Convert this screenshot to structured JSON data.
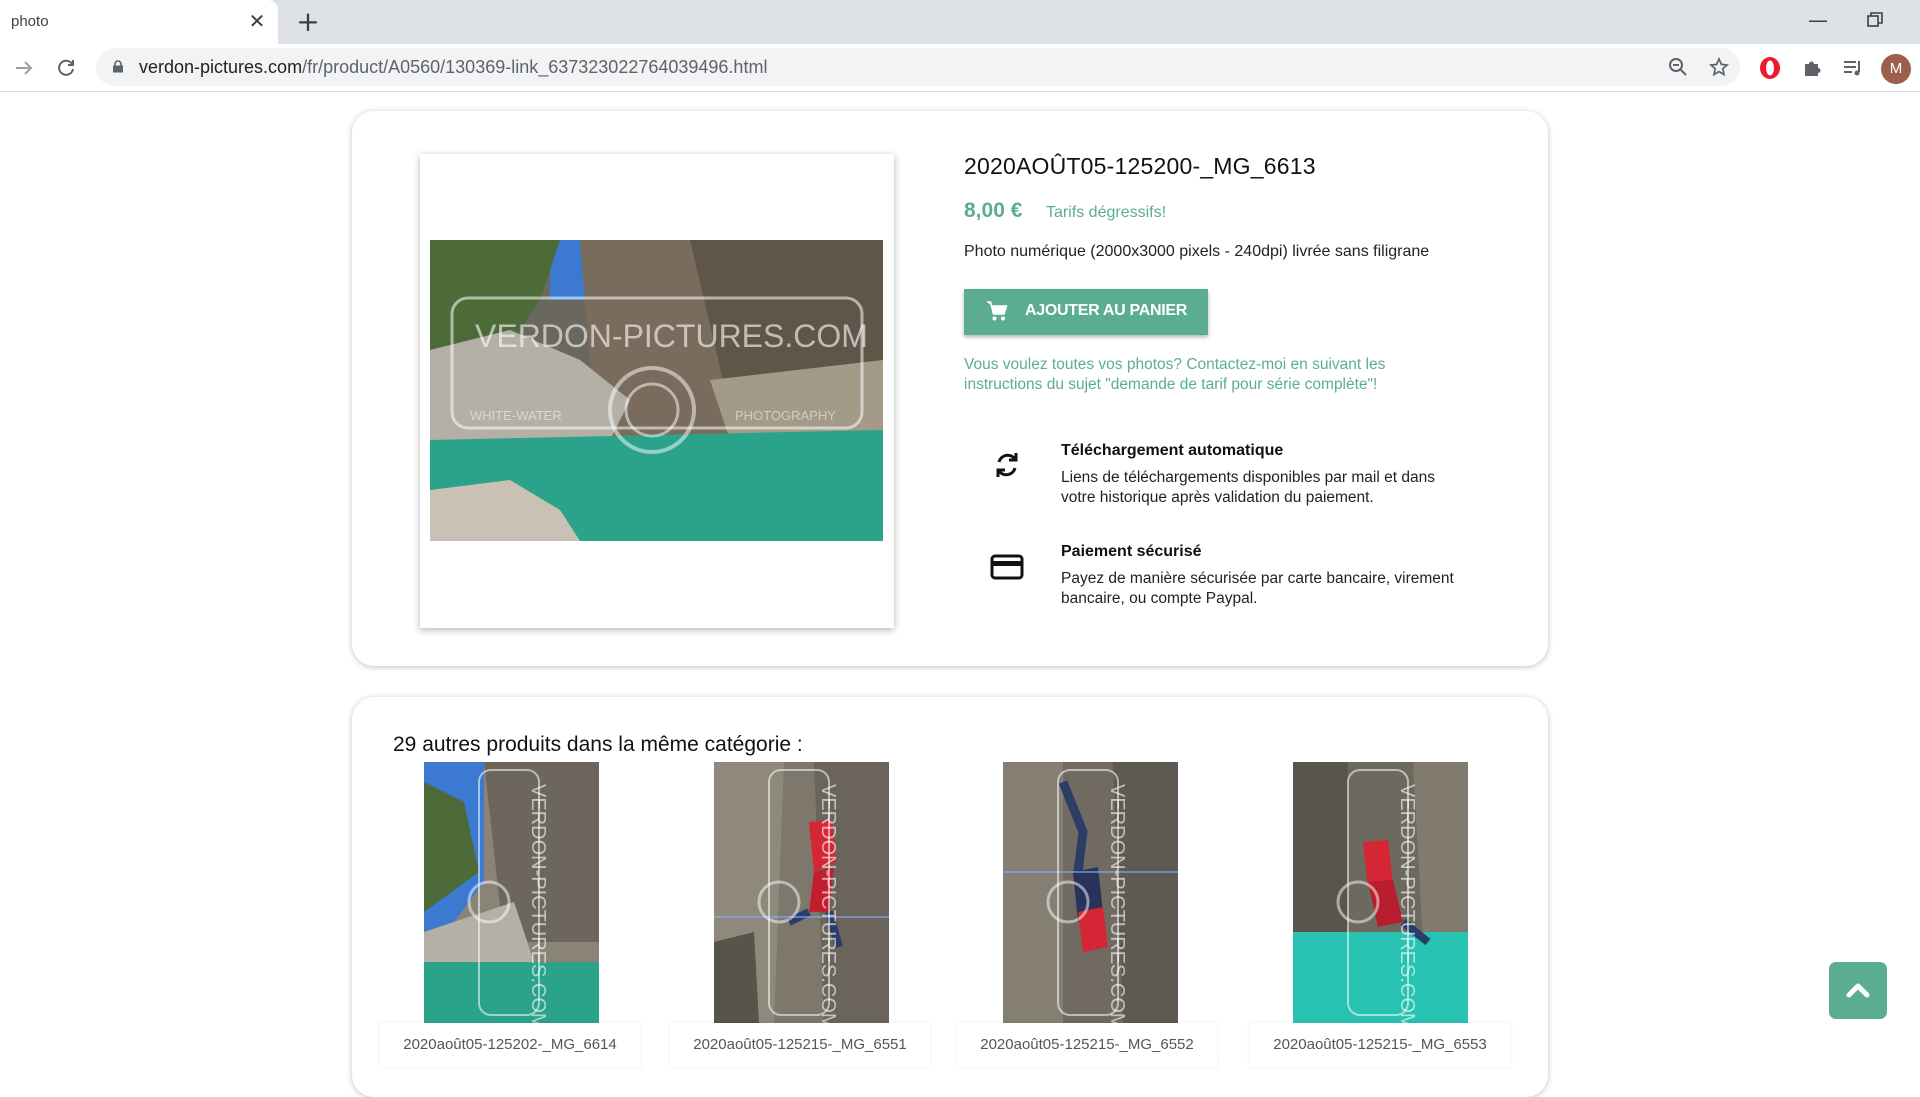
{
  "browser": {
    "tab_title": "photo",
    "tab_close": "✕",
    "new_tab": "+",
    "url_domain": "verdon-pictures.com",
    "url_path": "/fr/product/A0560/130369-link_637323022764039496.html",
    "avatar_initial": "M",
    "minimize": "—"
  },
  "product": {
    "title": "2020AOÛT05-125200-_MG_6613",
    "price": "8,00 €",
    "degressive": "Tarifs dégressifs!",
    "description": "Photo numérique (2000x3000 pixels - 240dpi) livrée sans filigrane",
    "add_to_cart": "AJOUTER AU PANIER",
    "contact": "Vous voulez toutes vos photos? Contactez-moi en suivant les instructions du sujet \"demande de tarif pour série complète\"!",
    "watermark": "VERDON-PICTURES.COM",
    "watermark_left": "WHITE-WATER",
    "watermark_right": "PHOTOGRAPHY",
    "features": [
      {
        "title": "Téléchargement automatique",
        "text": "Liens de téléchargements disponibles par mail et dans votre historique après validation du paiement.",
        "icon": "sync-icon"
      },
      {
        "title": "Paiement sécurisé",
        "text": "Payez de manière sécurisée par carte bancaire, virement bancaire, ou compte Paypal.",
        "icon": "credit-card-icon"
      }
    ]
  },
  "related": {
    "title": "29 autres produits dans la même catégorie :",
    "items": [
      {
        "caption": "2020août05-125202-_MG_6614"
      },
      {
        "caption": "2020août05-125215-_MG_6551"
      },
      {
        "caption": "2020août05-125215-_MG_6552"
      },
      {
        "caption": "2020août05-125215-_MG_6553"
      }
    ]
  },
  "colors": {
    "accent": "#5aae8f",
    "water": "#2aa38a",
    "rock": "#8a8478"
  }
}
